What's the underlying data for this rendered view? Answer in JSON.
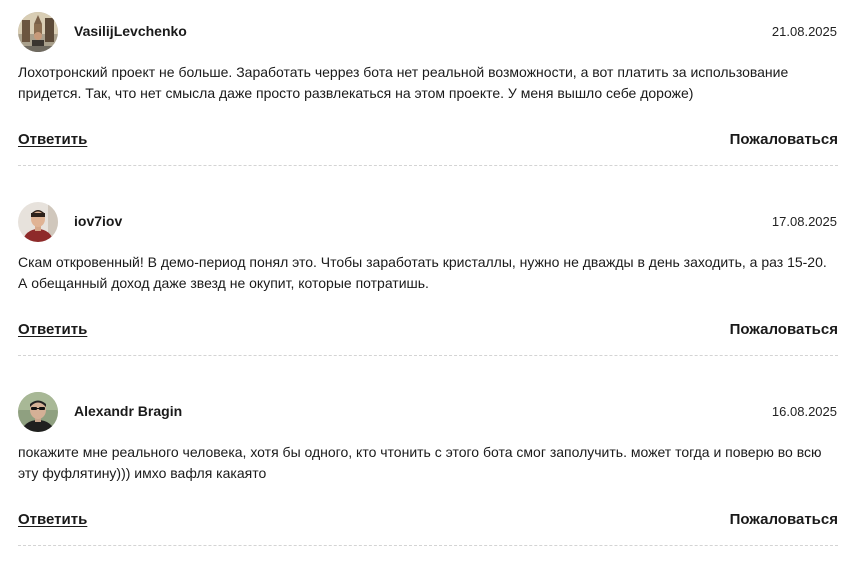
{
  "comments": [
    {
      "author": "VasilijLevchenko",
      "date": "21.08.2025",
      "text_lines": [
        "Лохотронский проект не больше. Заработать черрез бота нет реальной возможности, а вот платить за использование",
        "придется. Так, что нет смысла даже просто развлекаться на этом проекте. У меня вышло себе дороже)"
      ],
      "reply_label": "Ответить",
      "report_label": "Пожаловаться"
    },
    {
      "author": "iov7iov",
      "date": "17.08.2025",
      "text_lines": [
        "Скам откровенный! В демо-период понял это. Чтобы заработать кристаллы, нужно не дважды в день заходить, а раз 15-20.",
        "А обещанный доход даже звезд не окупит, которые потратишь."
      ],
      "reply_label": "Ответить",
      "report_label": "Пожаловаться"
    },
    {
      "author": "Alexandr Bragin",
      "date": "16.08.2025",
      "text_lines": [
        "покажите мне реального человека, хотя бы одного, кто чтонить с этого бота смог заполучить. может тогда и поверю во всю",
        "эту фуфлятину))) имхо вафля какаято"
      ],
      "reply_label": "Ответить",
      "report_label": "Пожаловаться"
    }
  ]
}
